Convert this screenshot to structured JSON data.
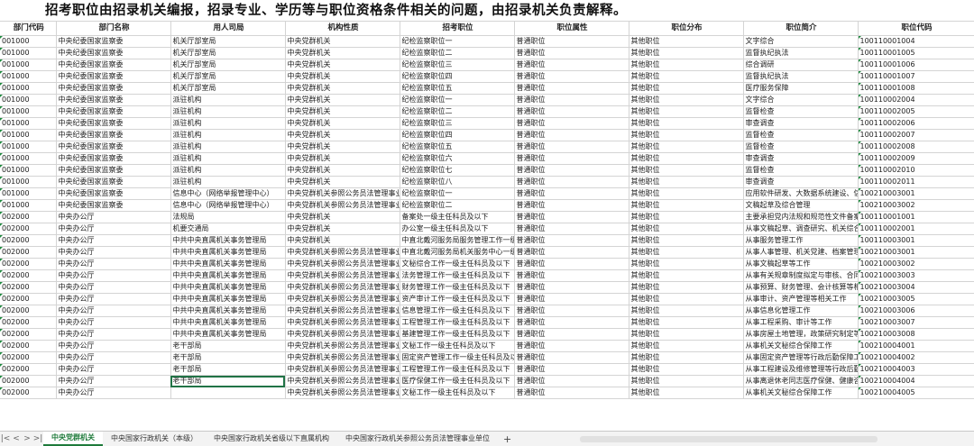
{
  "title": "招考职位由招录机关编报，招录专业、学历等与职位资格条件相关的问题，由招录机关负责解释。",
  "headers": [
    "部门代码",
    "部门名称",
    "用人司局",
    "机构性质",
    "招考职位",
    "职位属性",
    "职位分布",
    "职位简介",
    "职位代码"
  ],
  "rows": [
    [
      "001000",
      "中央纪委国家监察委",
      "机关厅部室局",
      "中央党群机关",
      "纪检监察职位一",
      "普通职位",
      "其他职位",
      "文字综合",
      "100110001004"
    ],
    [
      "001000",
      "中央纪委国家监察委",
      "机关厅部室局",
      "中央党群机关",
      "纪检监察职位二",
      "普通职位",
      "其他职位",
      "监督执纪执法",
      "100110001005"
    ],
    [
      "001000",
      "中央纪委国家监察委",
      "机关厅部室局",
      "中央党群机关",
      "纪检监察职位三",
      "普通职位",
      "其他职位",
      "综合调研",
      "100110001006"
    ],
    [
      "001000",
      "中央纪委国家监察委",
      "机关厅部室局",
      "中央党群机关",
      "纪检监察职位四",
      "普通职位",
      "其他职位",
      "监督执纪执法",
      "100110001007"
    ],
    [
      "001000",
      "中央纪委国家监察委",
      "机关厅部室局",
      "中央党群机关",
      "纪检监察职位五",
      "普通职位",
      "其他职位",
      "医疗服务保障",
      "100110001008"
    ],
    [
      "001000",
      "中央纪委国家监察委",
      "派驻机构",
      "中央党群机关",
      "纪检监察职位一",
      "普通职位",
      "其他职位",
      "文字综合",
      "100110002004"
    ],
    [
      "001000",
      "中央纪委国家监察委",
      "派驻机构",
      "中央党群机关",
      "纪检监察职位二",
      "普通职位",
      "其他职位",
      "监督检查",
      "100110002005"
    ],
    [
      "001000",
      "中央纪委国家监察委",
      "派驻机构",
      "中央党群机关",
      "纪检监察职位三",
      "普通职位",
      "其他职位",
      "审查调查",
      "100110002006"
    ],
    [
      "001000",
      "中央纪委国家监察委",
      "派驻机构",
      "中央党群机关",
      "纪检监察职位四",
      "普通职位",
      "其他职位",
      "监督检查",
      "100110002007"
    ],
    [
      "001000",
      "中央纪委国家监察委",
      "派驻机构",
      "中央党群机关",
      "纪检监察职位五",
      "普通职位",
      "其他职位",
      "监督检查",
      "100110002008"
    ],
    [
      "001000",
      "中央纪委国家监察委",
      "派驻机构",
      "中央党群机关",
      "纪检监察职位六",
      "普通职位",
      "其他职位",
      "审查调查",
      "100110002009"
    ],
    [
      "001000",
      "中央纪委国家监察委",
      "派驻机构",
      "中央党群机关",
      "纪检监察职位七",
      "普通职位",
      "其他职位",
      "监督检查",
      "100110002010"
    ],
    [
      "001000",
      "中央纪委国家监察委",
      "派驻机构",
      "中央党群机关",
      "纪检监察职位八",
      "普通职位",
      "其他职位",
      "审查调查",
      "100110002011"
    ],
    [
      "001000",
      "中央纪委国家监察委",
      "信息中心（网络举报管理中心）",
      "中央党群机关参照公务员法管理事业",
      "纪检监察职位一",
      "普通职位",
      "其他职位",
      "应用软件研发、大数据系统建设、信",
      "100210003001"
    ],
    [
      "001000",
      "中央纪委国家监察委",
      "信息中心（网络举报管理中心）",
      "中央党群机关参照公务员法管理事业",
      "纪检监察职位二",
      "普通职位",
      "其他职位",
      "文稿起草及综合管理",
      "100210003002"
    ],
    [
      "002000",
      "中央办公厅",
      "法规局",
      "中央党群机关",
      "备案处一级主任科员及以下",
      "普通职位",
      "其他职位",
      "主要承担党内法规和规范性文件备案",
      "100110001001"
    ],
    [
      "002000",
      "中央办公厅",
      "机要交通局",
      "中央党群机关",
      "办公室一级主任科员及以下",
      "普通职位",
      "其他职位",
      "从事文稿起草、调查研究、机关综合",
      "100110002001"
    ],
    [
      "002000",
      "中央办公厅",
      "中共中央直属机关事务管理局",
      "中央党群机关",
      "中直北戴河服务局服务管理工作一级",
      "普通职位",
      "其他职位",
      "从事服务管理工作",
      "100110003001"
    ],
    [
      "002000",
      "中央办公厅",
      "中共中央直属机关事务管理局",
      "中央党群机关参照公务员法管理事业",
      "中直北戴河服务局机关服务中心一级",
      "普通职位",
      "其他职位",
      "从事人事管理、机关党建、档案管理",
      "100210003001"
    ],
    [
      "002000",
      "中央办公厅",
      "中共中央直属机关事务管理局",
      "中央党群机关参照公务员法管理事业",
      "文秘综合工作一级主任科员及以下",
      "普通职位",
      "其他职位",
      "从事文稿起草等工作",
      "100210003002"
    ],
    [
      "002000",
      "中央办公厅",
      "中共中央直属机关事务管理局",
      "中央党群机关参照公务员法管理事业",
      "法务管理工作一级主任科员及以下",
      "普通职位",
      "其他职位",
      "从事有关规章制度拟定与审核、合同",
      "100210003003"
    ],
    [
      "002000",
      "中央办公厅",
      "中共中央直属机关事务管理局",
      "中央党群机关参照公务员法管理事业",
      "财务管理工作一级主任科员及以下",
      "普通职位",
      "其他职位",
      "从事预算、财务管理、会计核算等相",
      "100210003004"
    ],
    [
      "002000",
      "中央办公厅",
      "中共中央直属机关事务管理局",
      "中央党群机关参照公务员法管理事业",
      "资产审计工作一级主任科员及以下",
      "普通职位",
      "其他职位",
      "从事审计、资产管理等相关工作",
      "100210003005"
    ],
    [
      "002000",
      "中央办公厅",
      "中共中央直属机关事务管理局",
      "中央党群机关参照公务员法管理事业",
      "信息管理工作一级主任科员及以下",
      "普通职位",
      "其他职位",
      "从事信息化管理工作",
      "100210003006"
    ],
    [
      "002000",
      "中央办公厅",
      "中共中央直属机关事务管理局",
      "中央党群机关参照公务员法管理事业",
      "工程管理工作一级主任科员及以下",
      "普通职位",
      "其他职位",
      "从事工程采购、审计等工作",
      "100210003007"
    ],
    [
      "002000",
      "中央办公厅",
      "中共中央直属机关事务管理局",
      "中央党群机关参照公务员法管理事业",
      "基建管理工作一级主任科员及以下",
      "普通职位",
      "其他职位",
      "从事房屋土地管理，政策研究制定等",
      "100210003008"
    ],
    [
      "002000",
      "中央办公厅",
      "老干部局",
      "中央党群机关参照公务员法管理事业",
      "文秘工作一级主任科员及以下",
      "普通职位",
      "其他职位",
      "从事机关文秘综合保障工作",
      "100210004001"
    ],
    [
      "002000",
      "中央办公厅",
      "老干部局",
      "中央党群机关参照公务员法管理事业",
      "固定资产管理工作一级主任科员及以",
      "普通职位",
      "其他职位",
      "从事固定资产管理等行政后勤保障工",
      "100210004002"
    ],
    [
      "002000",
      "中央办公厅",
      "老干部局",
      "中央党群机关参照公务员法管理事业",
      "工程管理工作一级主任科员及以下",
      "普通职位",
      "其他职位",
      "从事工程建设及维修管理等行政后勤",
      "100210004003"
    ],
    [
      "002000",
      "中央办公厅",
      "老干部局",
      "中央党群机关参照公务员法管理事业",
      "医疗保健工作一级主任科员及以下",
      "普通职位",
      "其他职位",
      "从事离退休老同志医疗保健、健康咨",
      "100210004004"
    ],
    [
      "002000",
      "中央办公厅",
      "",
      "中央党群机关参照公务员法管理事业",
      "文秘工作一级主任科员及以下",
      "普通职位",
      "其他职位",
      "从事机关文秘综合保障工作",
      "100210004005"
    ]
  ],
  "sheet_tabs": [
    "中央党群机关",
    "中央国家行政机关（本级）",
    "中央国家行政机关省级以下直属机构",
    "中央国家行政机关参照公务员法管理事业单位"
  ],
  "tabbar": {
    "nav_icons": [
      "|<",
      "<",
      ">",
      ">|"
    ],
    "add_tab": "+"
  }
}
